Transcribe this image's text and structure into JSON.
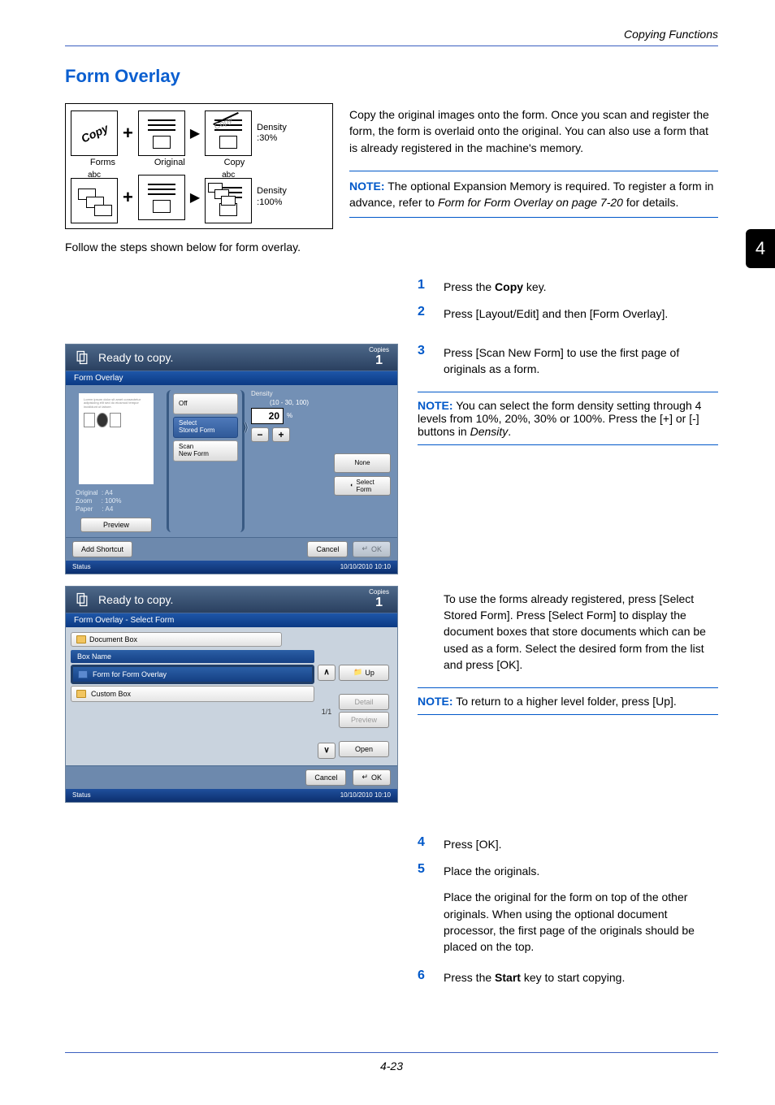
{
  "running_header": "Copying Functions",
  "title": "Form Overlay",
  "side_tab": "4",
  "diagram": {
    "row1": {
      "cell1_label": "Forms",
      "cell2_label": "Original",
      "cell3_label": "Copy",
      "density_line1": "Density",
      "density_line2": ":30%",
      "copy_word": "Copy"
    },
    "row2": {
      "abc1": "abc",
      "abc2": "abc",
      "density_line1": "Density",
      "density_line2": ":100%"
    }
  },
  "intro_para": "Copy the original images onto the form. Once you scan and register the form, the form is overlaid onto the original. You can also use a form that is already registered in the machine's memory.",
  "note1": {
    "prefix": "NOTE:",
    "text": " The optional Expansion Memory is required. To register a form in advance, refer to ",
    "ref": "Form for Form Overlay on page 7-20",
    "suffix": " for details."
  },
  "follow": "Follow the steps shown below for form overlay.",
  "step1": "Press the ",
  "step1_bold": "Copy",
  "step1_suffix": " key.",
  "step2": "Press [Layout/Edit] and then [Form Overlay].",
  "step3": "Press [Scan New Form] to use the first page of originals as a form.",
  "note2": {
    "prefix": "NOTE:",
    "text1": " You can select the form density setting through 4 levels from 10%, 20%, 30% or 100%. Press the [+] or [-] buttons in ",
    "italic": "Density",
    "suffix": "."
  },
  "stored_form_para": "To use the forms already registered, press [Select Stored Form]. Press [Select Form] to display the document boxes that store documents which can be used as a form. Select the desired form from the list and press [OK].",
  "note3": {
    "prefix": "NOTE:",
    "text": " To return to a higher level folder, press [Up]."
  },
  "step4": "Press [OK].",
  "step5a": "Place the originals.",
  "step5b": "Place the original for the form on top of the other originals. When using the optional document processor, the first page of the originals should be placed on the top.",
  "step6": "Press the ",
  "step6_bold": "Start",
  "step6_suffix": " key to start copying.",
  "panel1": {
    "ready": "Ready to copy.",
    "copies_label": "Copies",
    "copies": "1",
    "banner": "Form Overlay",
    "off": "Off",
    "select_stored": "Select Stored Form",
    "scan_new": "Scan New Form",
    "density_label": "Density",
    "density_range": "(10 - 30, 100)",
    "density_value": "20",
    "pct": "%",
    "none": "None",
    "select_form": "Select Form",
    "original": "Original",
    "original_v": ": A4",
    "zoom": "Zoom",
    "zoom_v": ": 100%",
    "paper": "Paper",
    "paper_v": ": A4",
    "preview": "Preview",
    "add_shortcut": "Add Shortcut",
    "cancel": "Cancel",
    "ok": "OK",
    "status": "Status",
    "timestamp": "10/10/2010  10:10"
  },
  "panel2": {
    "ready": "Ready to copy.",
    "copies_label": "Copies",
    "copies": "1",
    "banner": "Form Overlay - Select Form",
    "doc_box": "Document Box",
    "box_name": "Box Name",
    "form_folder": "Form for Form Overlay",
    "custom_box": "Custom Box",
    "up": "Up",
    "detail": "Detail",
    "preview": "Preview",
    "open": "Open",
    "page_indicator": "1/1",
    "cancel": "Cancel",
    "ok": "OK",
    "status": "Status",
    "timestamp": "10/10/2010  10:10"
  },
  "footer": "4-23"
}
